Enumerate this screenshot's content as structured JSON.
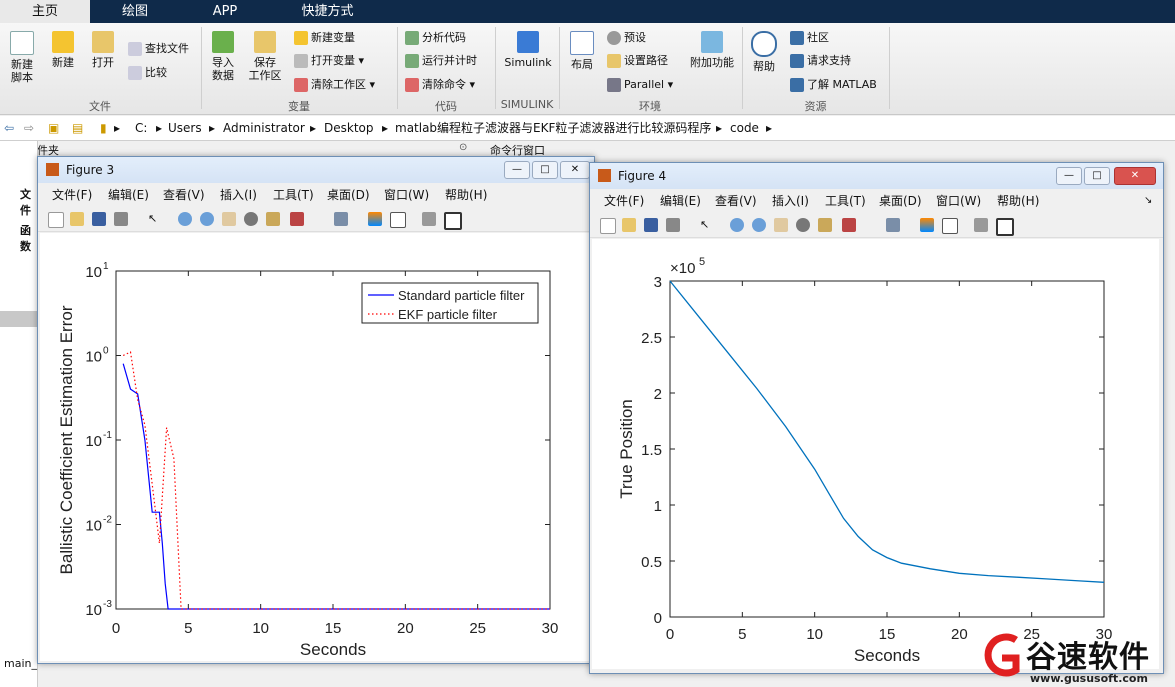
{
  "tabs": [
    {
      "label": "主页",
      "active": true
    },
    {
      "label": "绘图",
      "active": false
    },
    {
      "label": "APP",
      "active": false
    },
    {
      "label": "快捷方式",
      "active": false
    }
  ],
  "ribbon": {
    "file": {
      "new_script": "新建\n脚本",
      "new": "新建",
      "open": "打开",
      "find_files": "查找文件",
      "compare": "比较",
      "group": "文件"
    },
    "variable": {
      "import": "导入\n数据",
      "save_ws": "保存\n工作区",
      "new_var": "新建变量",
      "open_var": "打开变量",
      "clear_ws": "清除工作区",
      "group": "变量"
    },
    "code": {
      "analyze": "分析代码",
      "run_time": "运行并计时",
      "clear_cmd": "清除命令",
      "group": "代码"
    },
    "simulink": {
      "label": "Simulink",
      "group": "SIMULINK"
    },
    "env": {
      "layout": "布局",
      "prefs": "预设",
      "set_path": "设置路径",
      "parallel": "Parallel",
      "addons": "附加功能",
      "group": "环境"
    },
    "resources": {
      "help": "帮助",
      "community": "社区",
      "support": "请求支持",
      "learn": "了解 MATLAB",
      "group": "资源"
    }
  },
  "address": [
    "C:",
    "Users",
    "Administrator",
    "Desktop",
    "matlab编程粒子滤波器与EKF粒子滤波器进行比较源码程序",
    "code"
  ],
  "panels": {
    "current_folder": "当前文件夹",
    "command_window": "命令行窗口",
    "file_label": "文件",
    "func_label": "函数",
    "main_label": "main_"
  },
  "menu": [
    "文件(F)",
    "编辑(E)",
    "查看(V)",
    "插入(I)",
    "工具(T)",
    "桌面(D)",
    "窗口(W)",
    "帮助(H)"
  ],
  "figure3": {
    "title": "Figure 3",
    "chart_data": {
      "type": "line",
      "xlabel": "Seconds",
      "ylabel": "Ballistic Coefficient Estimation Error",
      "yscale": "log",
      "xlim": [
        0,
        30
      ],
      "ylim": [
        0.001,
        10
      ],
      "xticks": [
        "0",
        "5",
        "10",
        "15",
        "20",
        "25",
        "30"
      ],
      "yticks": [
        "10",
        "10",
        "10",
        "10",
        "10"
      ],
      "yexp": [
        "1",
        "0",
        "-1",
        "-2",
        "-3"
      ],
      "legend_position": "top-right",
      "series": [
        {
          "name": "Standard particle filter",
          "color": "#0000ff",
          "style": "solid",
          "x": [
            0.5,
            1.0,
            1.5,
            2.0,
            2.5,
            3.0,
            3.2,
            3.4,
            3.6,
            5,
            10,
            15,
            20,
            25,
            30
          ],
          "y": [
            0.8,
            0.4,
            0.35,
            0.1,
            0.014,
            0.014,
            0.006,
            0.002,
            0.001,
            0.001,
            0.001,
            0.001,
            0.001,
            0.001,
            0.001
          ]
        },
        {
          "name": "EKF particle filter",
          "color": "#ff0000",
          "style": "dotted",
          "x": [
            0.5,
            1.0,
            1.5,
            2.0,
            2.5,
            3.0,
            3.5,
            4.0,
            4.5,
            5,
            10,
            15,
            20,
            25,
            30
          ],
          "y": [
            1.0,
            1.1,
            0.3,
            0.15,
            0.03,
            0.006,
            0.14,
            0.06,
            0.001,
            0.001,
            0.001,
            0.001,
            0.001,
            0.001,
            0.001
          ]
        }
      ]
    }
  },
  "figure4": {
    "title": "Figure 4",
    "chart_data": {
      "type": "line",
      "xlabel": "Seconds",
      "ylabel": "True Position",
      "exponent_label": "×10",
      "exponent_power": "5",
      "xlim": [
        0,
        30
      ],
      "ylim": [
        0,
        3
      ],
      "xticks": [
        "0",
        "5",
        "10",
        "15",
        "20",
        "25",
        "30"
      ],
      "yticks": [
        "0",
        "0.5",
        "1",
        "1.5",
        "2",
        "2.5",
        "3"
      ],
      "series": [
        {
          "color": "#0072bd",
          "x": [
            0,
            2,
            4,
            6,
            8,
            10,
            11,
            12,
            13,
            14,
            15,
            16,
            18,
            20,
            22,
            24,
            26,
            28,
            30
          ],
          "y": [
            3.0,
            2.68,
            2.36,
            2.04,
            1.7,
            1.32,
            1.1,
            0.88,
            0.72,
            0.6,
            0.53,
            0.48,
            0.43,
            0.39,
            0.37,
            0.355,
            0.34,
            0.325,
            0.31
          ]
        }
      ]
    }
  },
  "watermark": {
    "text": "谷速软件",
    "url": "www.gususoft.com"
  }
}
